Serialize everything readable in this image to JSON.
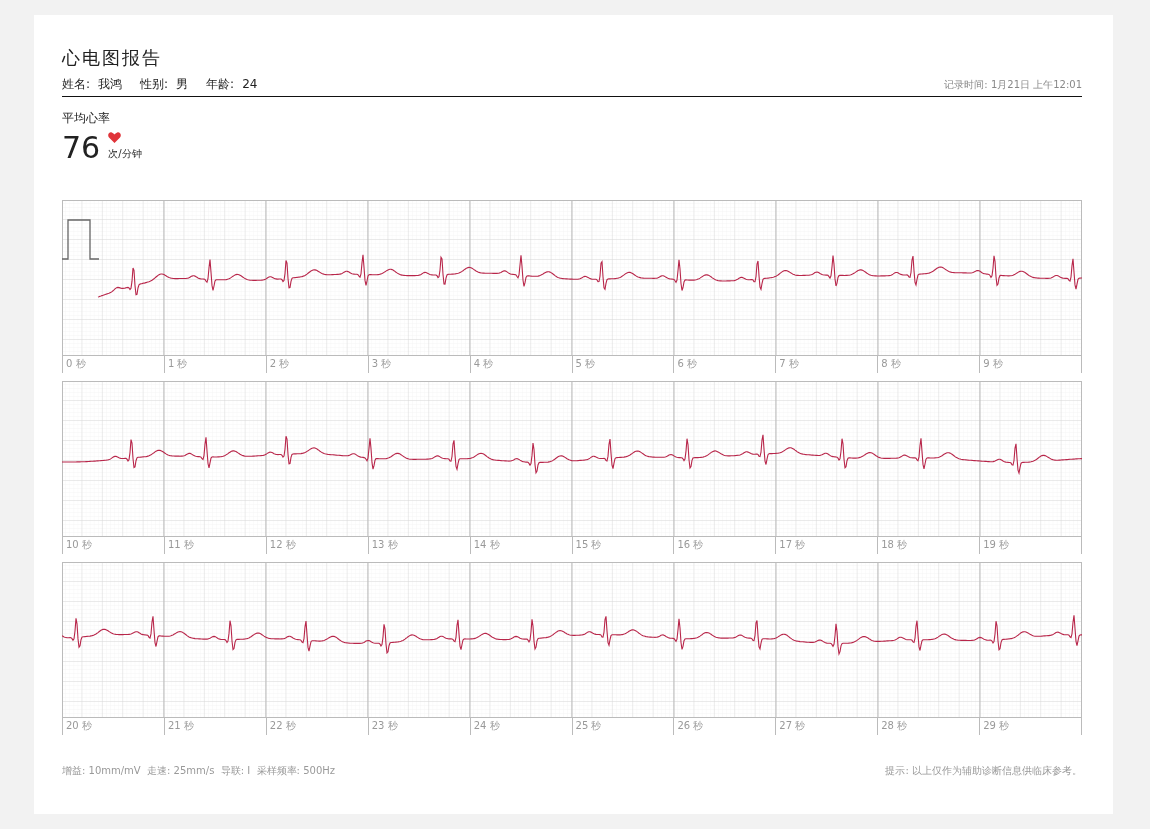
{
  "report": {
    "title": "心电图报告",
    "patient": [
      {
        "label": "姓名:",
        "value": "我鸿"
      },
      {
        "label": "性别:",
        "value": "男"
      },
      {
        "label": "年龄:",
        "value": "24"
      }
    ],
    "record_time": "记录时间: 1月21日 上午12:01"
  },
  "heart_rate": {
    "label": "平均心率",
    "value": "76",
    "unit": "次/分钟"
  },
  "strips": [
    {
      "calibration": true,
      "time_labels": [
        "0 秒",
        "1 秒",
        "2 秒",
        "3 秒",
        "4 秒",
        "5 秒",
        "6 秒",
        "7 秒",
        "8 秒",
        "9 秒"
      ]
    },
    {
      "calibration": false,
      "time_labels": [
        "10 秒",
        "11 秒",
        "12 秒",
        "13 秒",
        "14 秒",
        "15 秒",
        "16 秒",
        "17 秒",
        "18 秒",
        "19 秒"
      ]
    },
    {
      "calibration": false,
      "time_labels": [
        "20 秒",
        "21 秒",
        "22 秒",
        "23 秒",
        "24 秒",
        "25 秒",
        "26 秒",
        "27 秒",
        "28 秒",
        "29 秒"
      ]
    }
  ],
  "footer": {
    "settings": "增益: 10mm/mV  走速: 25mm/s  导联: I  采样频率: 500Hz",
    "note": "提示: 以上仅作为辅助诊断信息供临床参考。"
  }
}
